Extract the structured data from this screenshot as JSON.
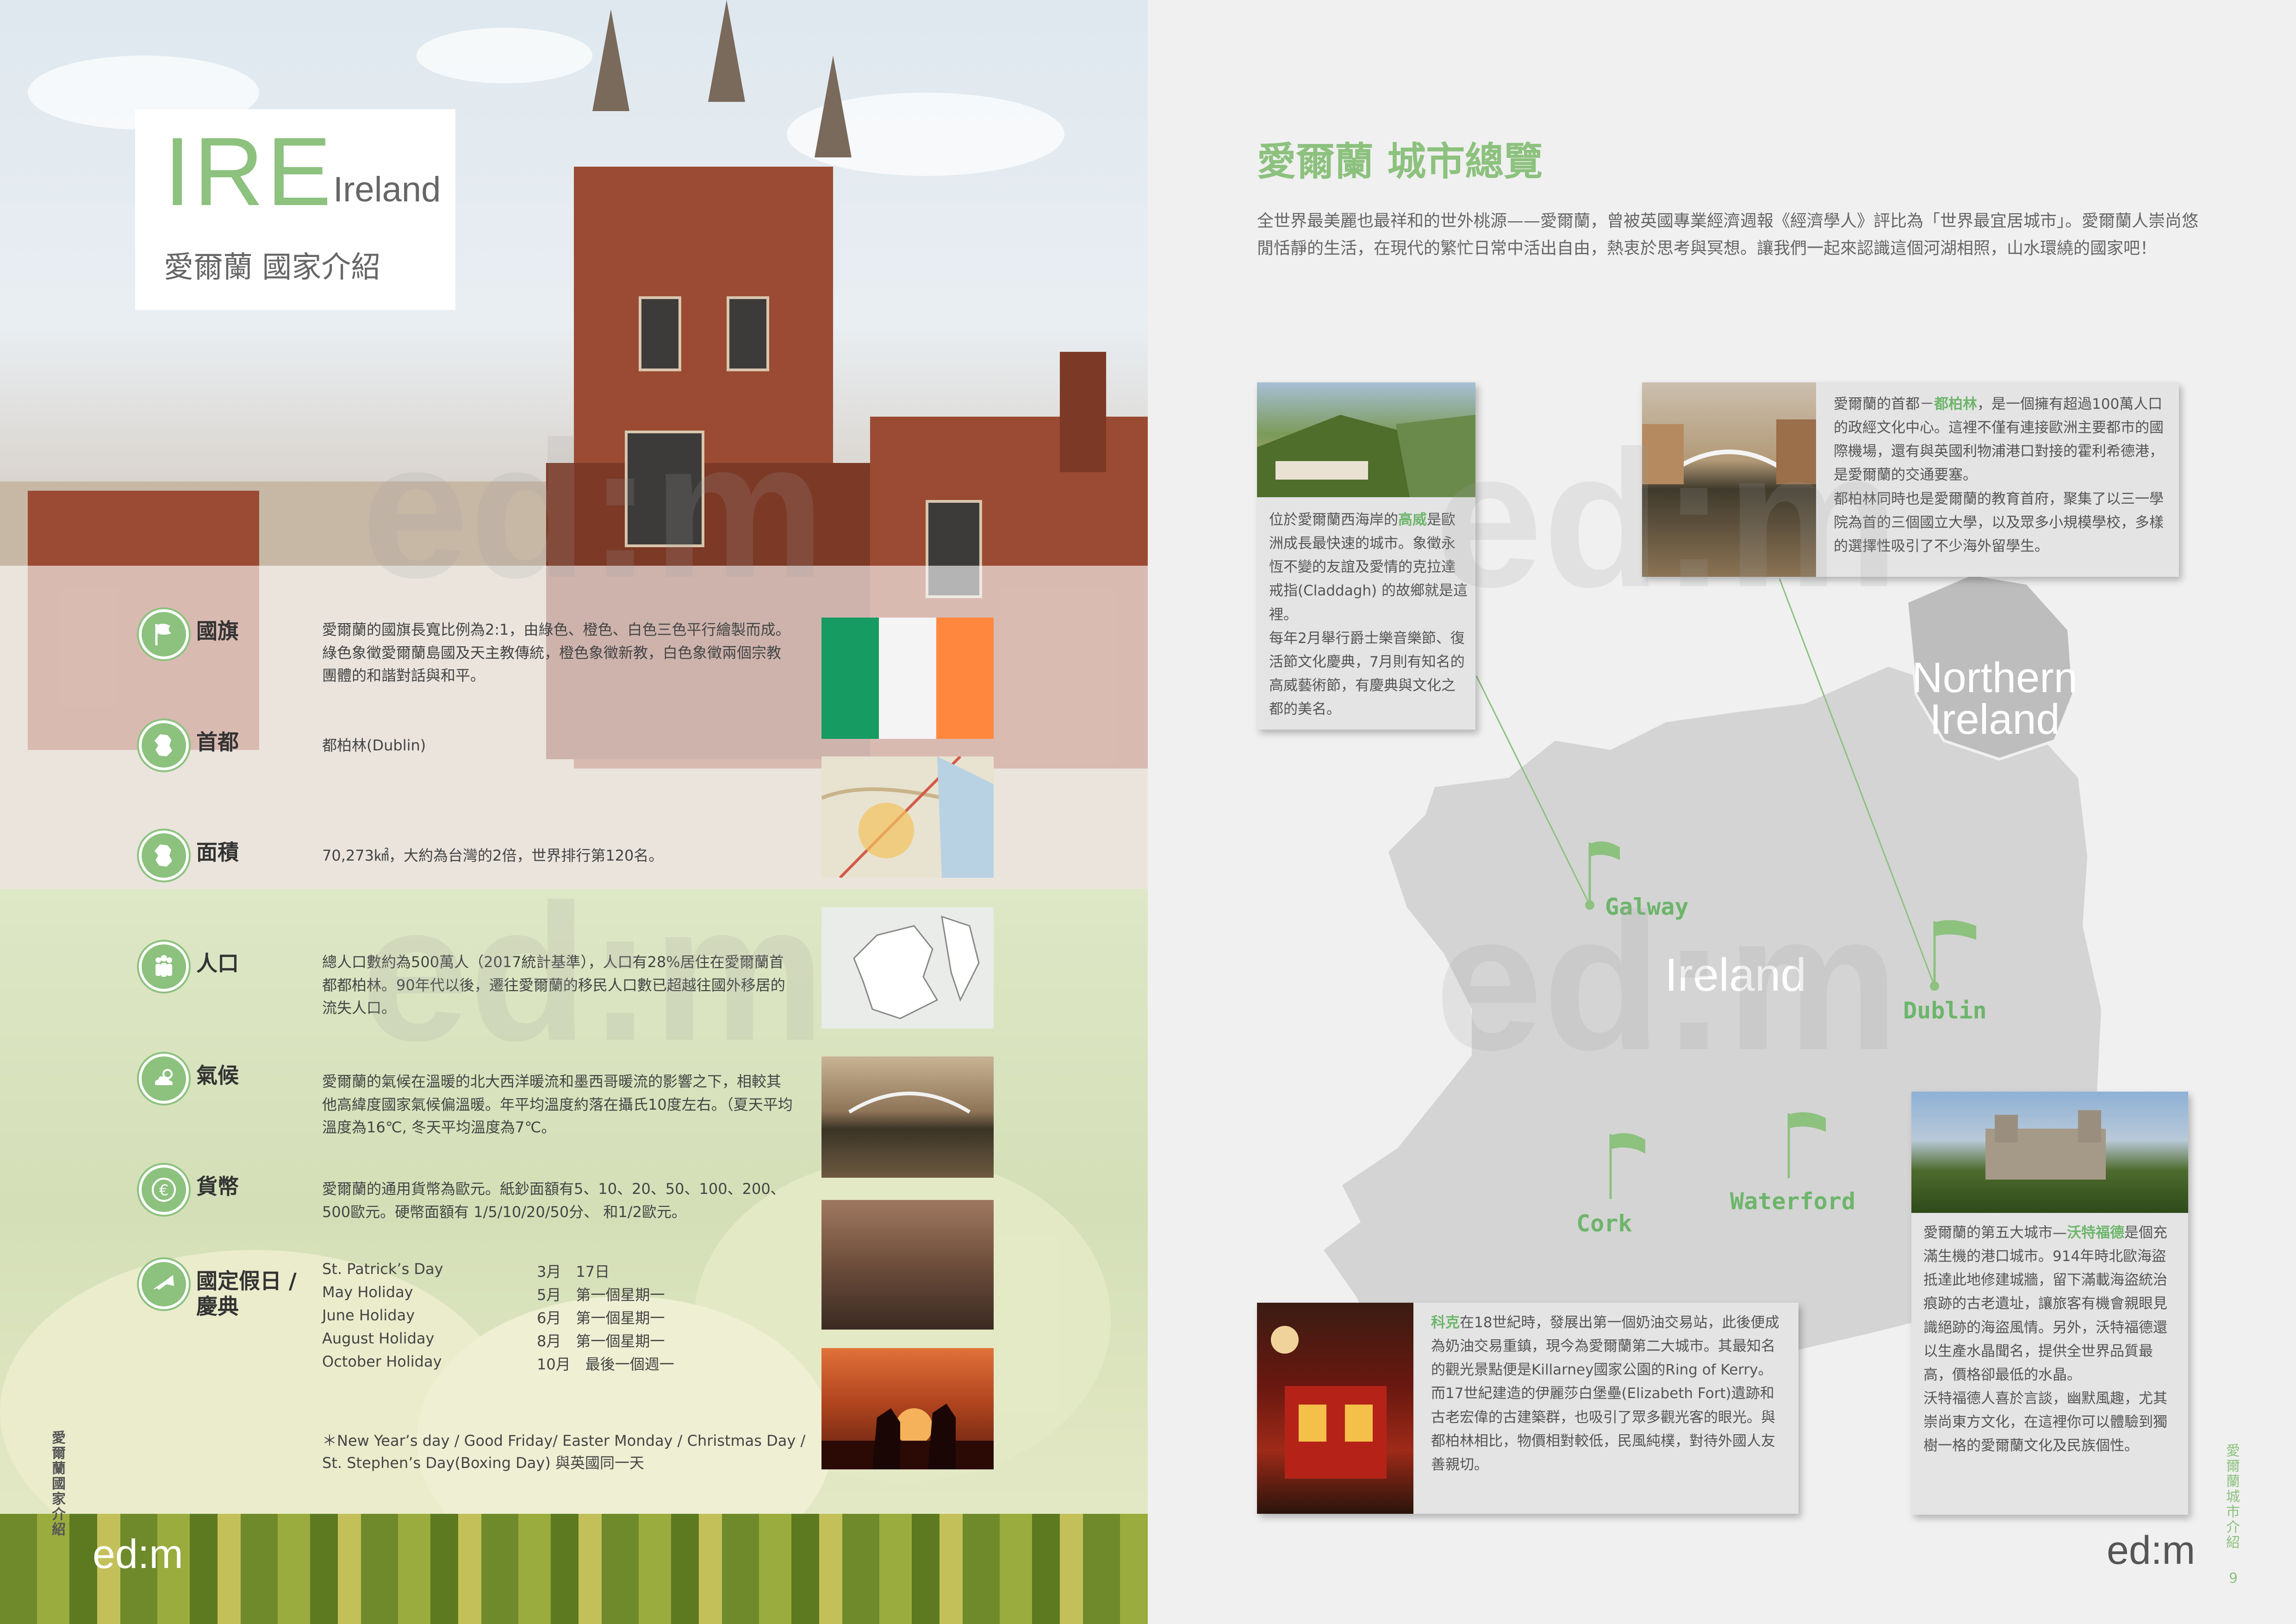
{
  "left_page": {
    "title_abbr": "IRE",
    "title_en": "Ireland",
    "title_zh": "愛爾蘭 國家介紹",
    "rows": [
      {
        "label": "國旗",
        "text": "愛爾蘭的國旗長寬比例為2:1，由綠色、橙色、白色三色平行繪製而成。綠色象徵愛爾蘭島國及天主教傳統，橙色象徵新教，白色象徵兩個宗教團體的和諧對話與和平。",
        "icon": "flag-icon"
      },
      {
        "label": "首都",
        "text": "都柏林(Dublin)",
        "icon": "ireland-island-icon"
      },
      {
        "label": "面積",
        "text": "70,273㎢，大約為台灣的2倍，世界排行第120名。",
        "icon": "ireland-island-icon"
      },
      {
        "label": "人口",
        "text": "總人口數約為500萬人（2017統計基準），人口有28%居住在愛爾蘭首都都柏林。90年代以後，遷往愛爾蘭的移民人口數已超越往國外移居的流失人口。",
        "icon": "people-icon"
      },
      {
        "label": "氣候",
        "text": "愛爾蘭的氣候在溫暖的北大西洋暖流和墨西哥暖流的影響之下，相較其他高緯度國家氣候偏溫暖。年平均溫度約落在攝氏10度左右。（夏天平均溫度為16℃, 冬天平均溫度為7℃。",
        "icon": "weather-icon"
      },
      {
        "label": "貨幣",
        "text": "愛爾蘭的通用貨幣為歐元。紙鈔面額有5、10、20、50、100、200、500歐元。硬幣面額有 1/5/10/20/50分、 和1/2歐元。",
        "icon": "euro-icon"
      }
    ],
    "holiday_label": "國定假日 / 慶典",
    "holidays": [
      {
        "name": "St. Patrick’s Day",
        "date": "3月　17日"
      },
      {
        "name": "May Holiday",
        "date": "5月　第一個星期一"
      },
      {
        "name": "June Holiday",
        "date": "6月　第一個星期一"
      },
      {
        "name": "August Holiday",
        "date": "8月　第一個星期一"
      },
      {
        "name": "October Holiday",
        "date": "10月　最後一個週一"
      }
    ],
    "footnote": "＊New Year’s day / Good Friday/ Easter Monday / Christmas Day / St. Stephen’s Day(Boxing Day) 與英國同一天",
    "side_label": "愛爾蘭國家介紹",
    "logo": "ed:m"
  },
  "right_page": {
    "title": "愛爾蘭 城市總覽",
    "intro": "全世界最美麗也最祥和的世外桃源——愛爾蘭，曾被英國專業經濟週報《經濟學人》評比為「世界最宜居城市」。愛爾蘭人崇尚悠閒恬靜的生活，在現代的繁忙日常中活出自由，熱衷於思考與冥想。讓我們一起來認識這個河湖相照，山水環繞的國家吧！",
    "map_labels": {
      "north": "Northern Ireland",
      "ireland": "Ireland"
    },
    "cities": [
      "Galway",
      "Dublin",
      "Cork",
      "Waterford"
    ],
    "galway_card": {
      "pre": "位於愛爾蘭西海岸的",
      "highlight": "高威",
      "post": "是歐洲成長最快速的城市。象徵永恆不變的友誼及愛情的克拉達戒指(Claddagh) 的故鄉就是這裡。",
      "p2": "每年2月舉行爵士樂音樂節、復活節文化慶典，7月則有知名的高威藝術節，有慶典與文化之都的美名。"
    },
    "dublin_card": {
      "pre": "愛爾蘭的首都－",
      "highlight": "都柏林",
      "post": "，是一個擁有超過100萬人口的政經文化中心。這裡不僅有連接歐洲主要都市的國際機場，還有與英國利物浦港口對接的霍利希德港，是愛爾蘭的交通要塞。",
      "p2": "都柏林同時也是愛爾蘭的教育首府，聚集了以三一學院為首的三個國立大學，以及眾多小規模學校，多樣的選擇性吸引了不少海外留學生。"
    },
    "cork_card": {
      "highlight": "科克",
      "post": "在18世紀時，發展出第一個奶油交易站，此後便成為奶油交易重鎮，現今為愛爾蘭第二大城市。其最知名的觀光景點便是Killarney國家公園的Ring of Kerry。",
      "p2": "而17世紀建造的伊麗莎白堡壘(Elizabeth Fort)遺跡和古老宏偉的古建築群，也吸引了眾多觀光客的眼光。與都柏林相比，物價相對較低，民風純樸，對待外國人友善親切。"
    },
    "waterford_card": {
      "pre": "愛爾蘭的第五大城市—",
      "highlight": "沃特福德",
      "post": "是個充滿生機的港口城市。914年時北歐海盜抵達此地修建城牆，留下滿載海盜統治痕跡的古老遺址，讓旅客有機會親眼見識絕跡的海盜風情。另外，沃特福德還以生產水晶聞名，提供全世界品質最高，價格卻最低的水晶。",
      "p2": "沃特福德人喜於言談，幽默風趣，尤其崇尚東方文化，在這裡你可以體驗到獨樹一格的愛爾蘭文化及民族個性。"
    },
    "side_label": "愛爾蘭城市介紹",
    "page_number": "9",
    "logo": "ed:m"
  },
  "colors": {
    "accent": "#8cc17e",
    "city_label": "#6db56b",
    "map": "#d4d4d4"
  }
}
